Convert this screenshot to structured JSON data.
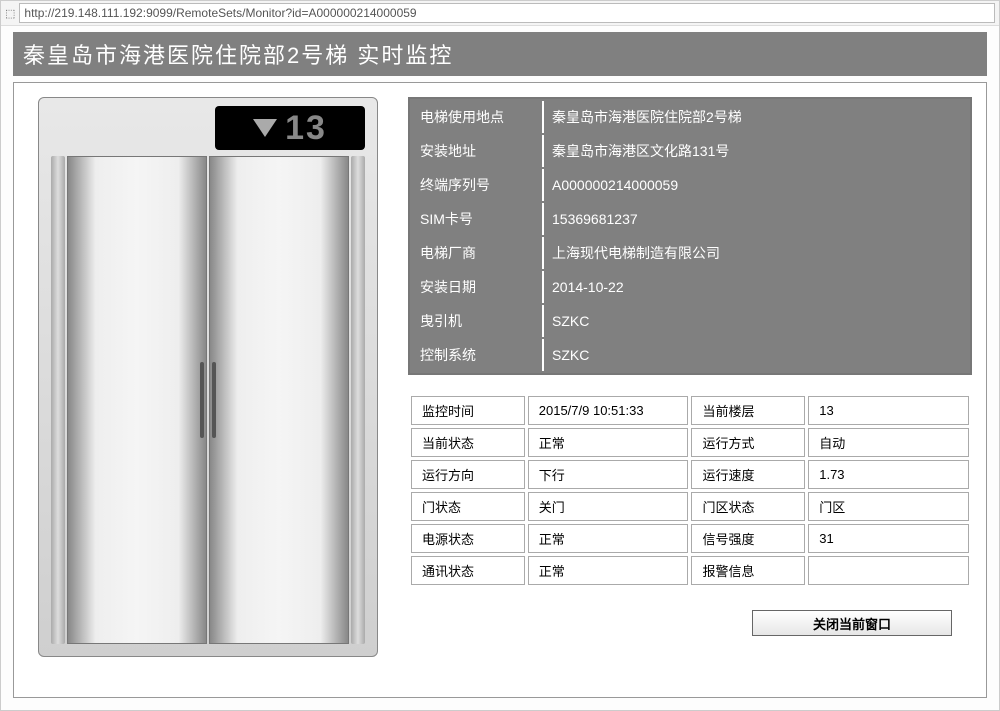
{
  "url": "http://219.148.111.192:9099/RemoteSets/Monitor?id=A000000214000059",
  "titleBar": "秦皇岛市海港医院住院部2号梯  实时监控",
  "floorDisplay": {
    "direction": "down",
    "floor": "13"
  },
  "infoTable": [
    {
      "label": "电梯使用地点",
      "value": "秦皇岛市海港医院住院部2号梯"
    },
    {
      "label": "安装地址",
      "value": "秦皇岛市海港区文化路131号"
    },
    {
      "label": "终端序列号",
      "value": "A000000214000059"
    },
    {
      "label": "SIM卡号",
      "value": "15369681237"
    },
    {
      "label": "电梯厂商",
      "value": "上海现代电梯制造有限公司"
    },
    {
      "label": "安装日期",
      "value": "2014-10-22"
    },
    {
      "label": "曳引机",
      "value": "SZKC"
    },
    {
      "label": "控制系统",
      "value": "SZKC"
    }
  ],
  "statusTable": [
    {
      "label1": "监控时间",
      "value1": "2015/7/9 10:51:33",
      "label2": "当前楼层",
      "value2": "13"
    },
    {
      "label1": "当前状态",
      "value1": "正常",
      "label2": "运行方式",
      "value2": "自动"
    },
    {
      "label1": "运行方向",
      "value1": "下行",
      "label2": "运行速度",
      "value2": "1.73"
    },
    {
      "label1": "门状态",
      "value1": "关门",
      "label2": "门区状态",
      "value2": "门区"
    },
    {
      "label1": "电源状态",
      "value1": "正常",
      "label2": "信号强度",
      "value2": "31"
    },
    {
      "label1": "通讯状态",
      "value1": "正常",
      "label2": "报警信息",
      "value2": ""
    }
  ],
  "closeBtn": "关闭当前窗口"
}
